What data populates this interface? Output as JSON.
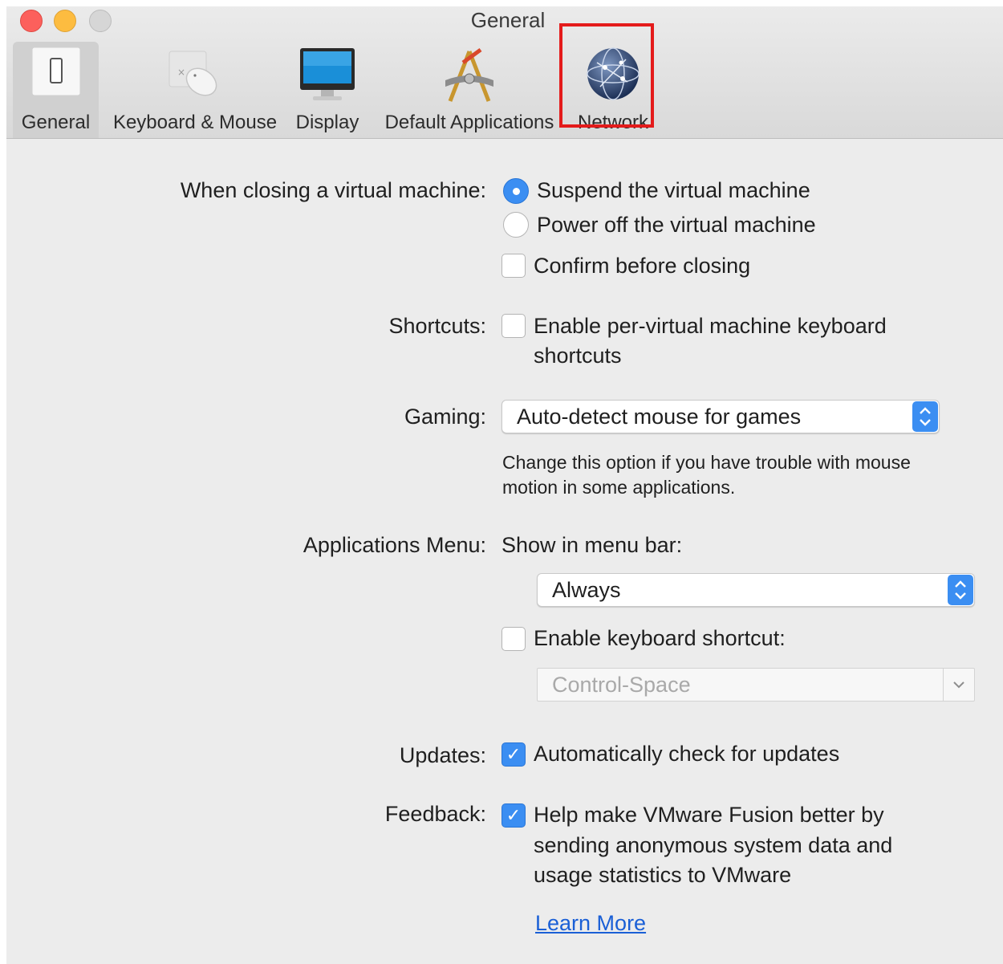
{
  "window": {
    "title": "General"
  },
  "toolbar": {
    "tabs": [
      {
        "id": "general",
        "label": "General",
        "icon": "switch-icon"
      },
      {
        "id": "keyboard-mouse",
        "label": "Keyboard & Mouse",
        "icon": "keyboard-mouse-icon"
      },
      {
        "id": "display",
        "label": "Display",
        "icon": "monitor-icon"
      },
      {
        "id": "default-applications",
        "label": "Default Applications",
        "icon": "applications-icon"
      },
      {
        "id": "network",
        "label": "Network",
        "icon": "globe-icon"
      }
    ],
    "selected": "General",
    "highlighted": "Network",
    "highlight_color": "#e41b1b"
  },
  "closing": {
    "label": "When closing a virtual machine:",
    "suspend": "Suspend the virtual machine",
    "power_off": "Power off the virtual machine",
    "confirm": "Confirm before closing"
  },
  "shortcuts": {
    "label": "Shortcuts:",
    "option_line1": "Enable per-virtual machine keyboard",
    "option_line2": "shortcuts"
  },
  "gaming": {
    "label": "Gaming:",
    "value": "Auto-detect mouse for games",
    "help_line1": "Change this option if you have trouble with mouse",
    "help_line2": "motion in some applications."
  },
  "apps_menu": {
    "label": "Applications Menu:",
    "show_label": "Show in menu bar:",
    "show_value": "Always",
    "shortcut_label": "Enable keyboard shortcut:",
    "shortcut_value": "Control-Space"
  },
  "updates": {
    "label": "Updates:",
    "option": "Automatically check for updates"
  },
  "feedback": {
    "label": "Feedback:",
    "line1": "Help make VMware Fusion better by",
    "line2": "sending anonymous system data and",
    "line3": "usage statistics to VMware",
    "learn_more": "Learn More"
  },
  "colors": {
    "accent": "#3b8ef2",
    "link": "#1a5fd6"
  }
}
